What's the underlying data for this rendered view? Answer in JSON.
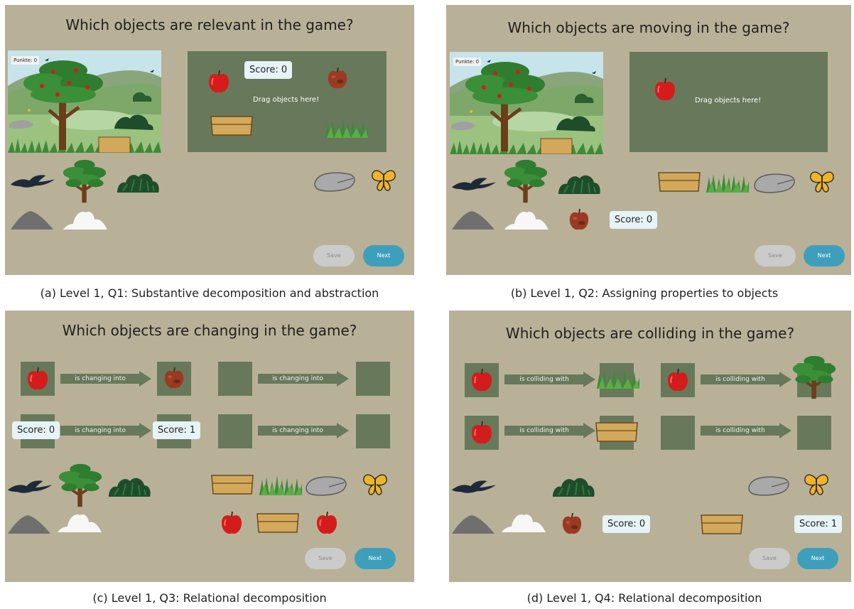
{
  "panels": {
    "a": {
      "title": "Which objects are relevant in the game?",
      "game_label": "Punkte: 0",
      "score": "Score: 0",
      "drag": "Drag objects here!",
      "save": "Save",
      "next": "Next",
      "caption": "(a) Level 1, Q1: Substantive decomposition and abstraction"
    },
    "b": {
      "title": "Which objects are moving in the game?",
      "game_label": "Punkte: 0",
      "score": "Score: 0",
      "drag": "Drag objects here!",
      "save": "Save",
      "next": "Next",
      "caption": "(b) Level 1, Q2: Assigning properties to objects"
    },
    "c": {
      "title": "Which objects are changing in the game?",
      "arrow_label": "is changing into",
      "score_left": "Score: 0",
      "score_right": "Score: 1",
      "save": "Save",
      "next": "Next",
      "caption": "(c) Level 1, Q3: Relational decomposition"
    },
    "d": {
      "title": "Which objects are colliding in the game?",
      "arrow_label": "is colliding with",
      "score_left": "Score: 0",
      "score_right": "Score: 1",
      "save": "Save",
      "next": "Next",
      "caption": "(d) Level 1, Q4: Relational decomposition"
    }
  },
  "colors": {
    "panel_bg": "#b8b198",
    "drop_area": "#67795a",
    "next_button": "#3e9fbc",
    "save_button": "#cbcbcb",
    "score_bg": "#e6f3f7"
  },
  "icons": [
    "bird-icon",
    "tree-icon",
    "bush-icon",
    "rock-icon",
    "butterfly-icon",
    "mountain-icon",
    "cloud-icon",
    "apple-icon",
    "rotten-apple-icon",
    "basket-icon",
    "grass-icon"
  ]
}
